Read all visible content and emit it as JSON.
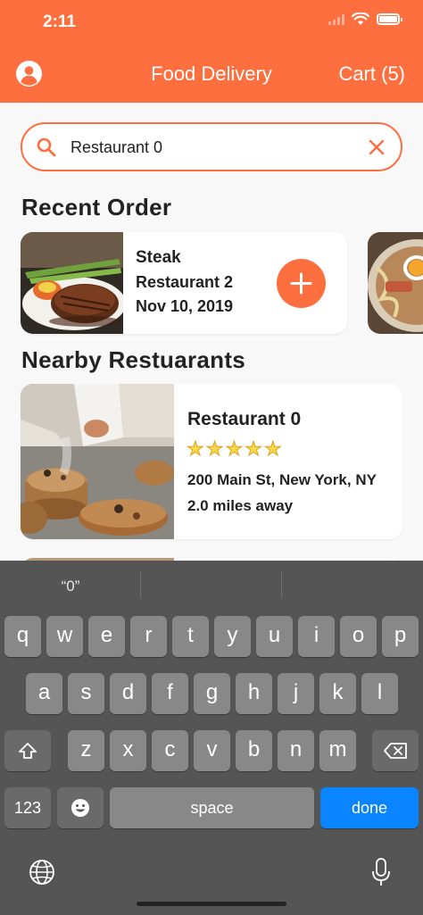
{
  "status_bar": {
    "time": "2:11"
  },
  "header": {
    "title": "Food Delivery",
    "cart_label": "Cart (5)"
  },
  "search": {
    "value": "Restaurant 0"
  },
  "recent_order": {
    "section_title": "Recent Order",
    "item": {
      "name": "Steak",
      "restaurant": "Restaurant 2",
      "date": "Nov 10, 2019"
    }
  },
  "nearby": {
    "section_title": "Nearby Restuarants",
    "items": [
      {
        "name": "Restaurant 0",
        "rating": 5,
        "address": "200 Main St, New York, NY",
        "distance": "2.0 miles away"
      }
    ]
  },
  "keyboard": {
    "suggestions": [
      "“0”",
      "",
      ""
    ],
    "row1": [
      "q",
      "w",
      "e",
      "r",
      "t",
      "y",
      "u",
      "i",
      "o",
      "p"
    ],
    "row2": [
      "a",
      "s",
      "d",
      "f",
      "g",
      "h",
      "j",
      "k",
      "l"
    ],
    "row3": [
      "z",
      "x",
      "c",
      "v",
      "b",
      "n",
      "m"
    ],
    "numbers_key": "123",
    "space_key": "space",
    "done_key": "done"
  },
  "colors": {
    "accent": "#fe6f3f",
    "keyboard_bg": "#555555",
    "key": "#888888",
    "done": "#0a84ff"
  },
  "icons": [
    "profile-icon",
    "search-icon",
    "clear-icon",
    "plus-icon",
    "star-icon",
    "shift-icon",
    "backspace-icon",
    "emoji-icon",
    "globe-icon",
    "mic-icon",
    "wifi-icon",
    "battery-icon",
    "signal-icon"
  ]
}
